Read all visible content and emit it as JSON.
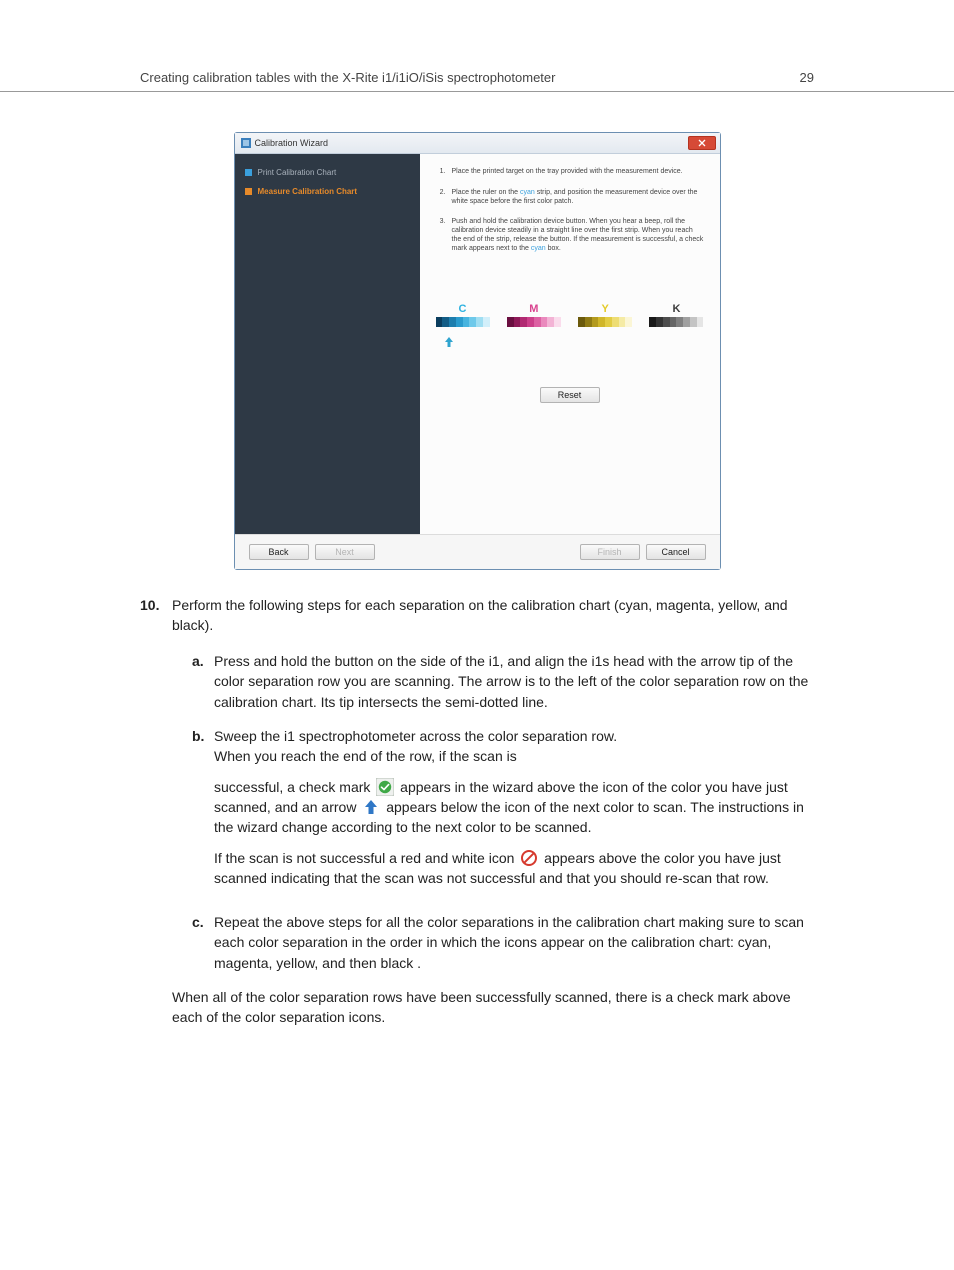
{
  "header": {
    "title": "Creating calibration tables with the X-Rite i1/i1iO/iSis spectrophotometer",
    "page": "29"
  },
  "wizard": {
    "title": "Calibration Wizard",
    "sidebar": {
      "items": [
        {
          "label": "Print Calibration Chart"
        },
        {
          "label": "Measure Calibration Chart"
        }
      ]
    },
    "instructions": [
      {
        "n": "1.",
        "text": "Place the printed target on the tray provided with the measurement device."
      },
      {
        "n": "2.",
        "pre": "Place the ruler on the ",
        "cyan": "cyan",
        "post": " strip, and position the measurement device over the white space before the first color patch."
      },
      {
        "n": "3.",
        "pre": "Push and hold the calibration device button. When you hear a beep, roll the calibration device steadily in a straight line over the first strip. When you reach the end of the strip, release the button. If the measurement is successful, a check mark appears next to the ",
        "cyan": "cyan",
        "post": " box."
      }
    ],
    "letters": {
      "c": "C",
      "m": "M",
      "y": "Y",
      "k": "K"
    },
    "reset": "Reset",
    "buttons": {
      "back": "Back",
      "next": "Next",
      "finish": "Finish",
      "cancel": "Cancel"
    }
  },
  "step10": {
    "num": "10.",
    "text": "Perform the following steps for each separation on the calibration chart (cyan, magenta, yellow, and black)."
  },
  "sub": {
    "a": {
      "label": "a.",
      "text": "Press and hold the button on the side of the i1, and align the i1s head with the arrow tip of the color separation row you are scanning. The arrow is to the left of the color separation row on the calibration chart. Its tip intersects the semi-dotted line."
    },
    "b": {
      "label": "b.",
      "p1": "Sweep the i1 spectrophotometer across the color separation row.",
      "p1b": "When you reach the end of the row, if the scan is",
      "p2a": "successful, a check mark",
      "p2b": "appears in the wizard above the icon of the color you have just scanned, and an arrow",
      "p2c": "appears below the icon of the next color to scan. The instructions in the wizard change according to the next color to be scanned.",
      "p3a": "If the scan is not successful a red and white icon",
      "p3b": "appears above the color you have just scanned indicating that the scan was not successful and that you should re-scan that row."
    },
    "c": {
      "label": "c.",
      "text": "Repeat the above steps for all the color separations in the calibration chart making sure to scan each color separation in the order in which the icons appear on the calibration chart: cyan, magenta, yellow, and then black ."
    }
  },
  "final": "When all of the color separation rows have been successfully scanned, there is a check mark above each of the color separation icons."
}
